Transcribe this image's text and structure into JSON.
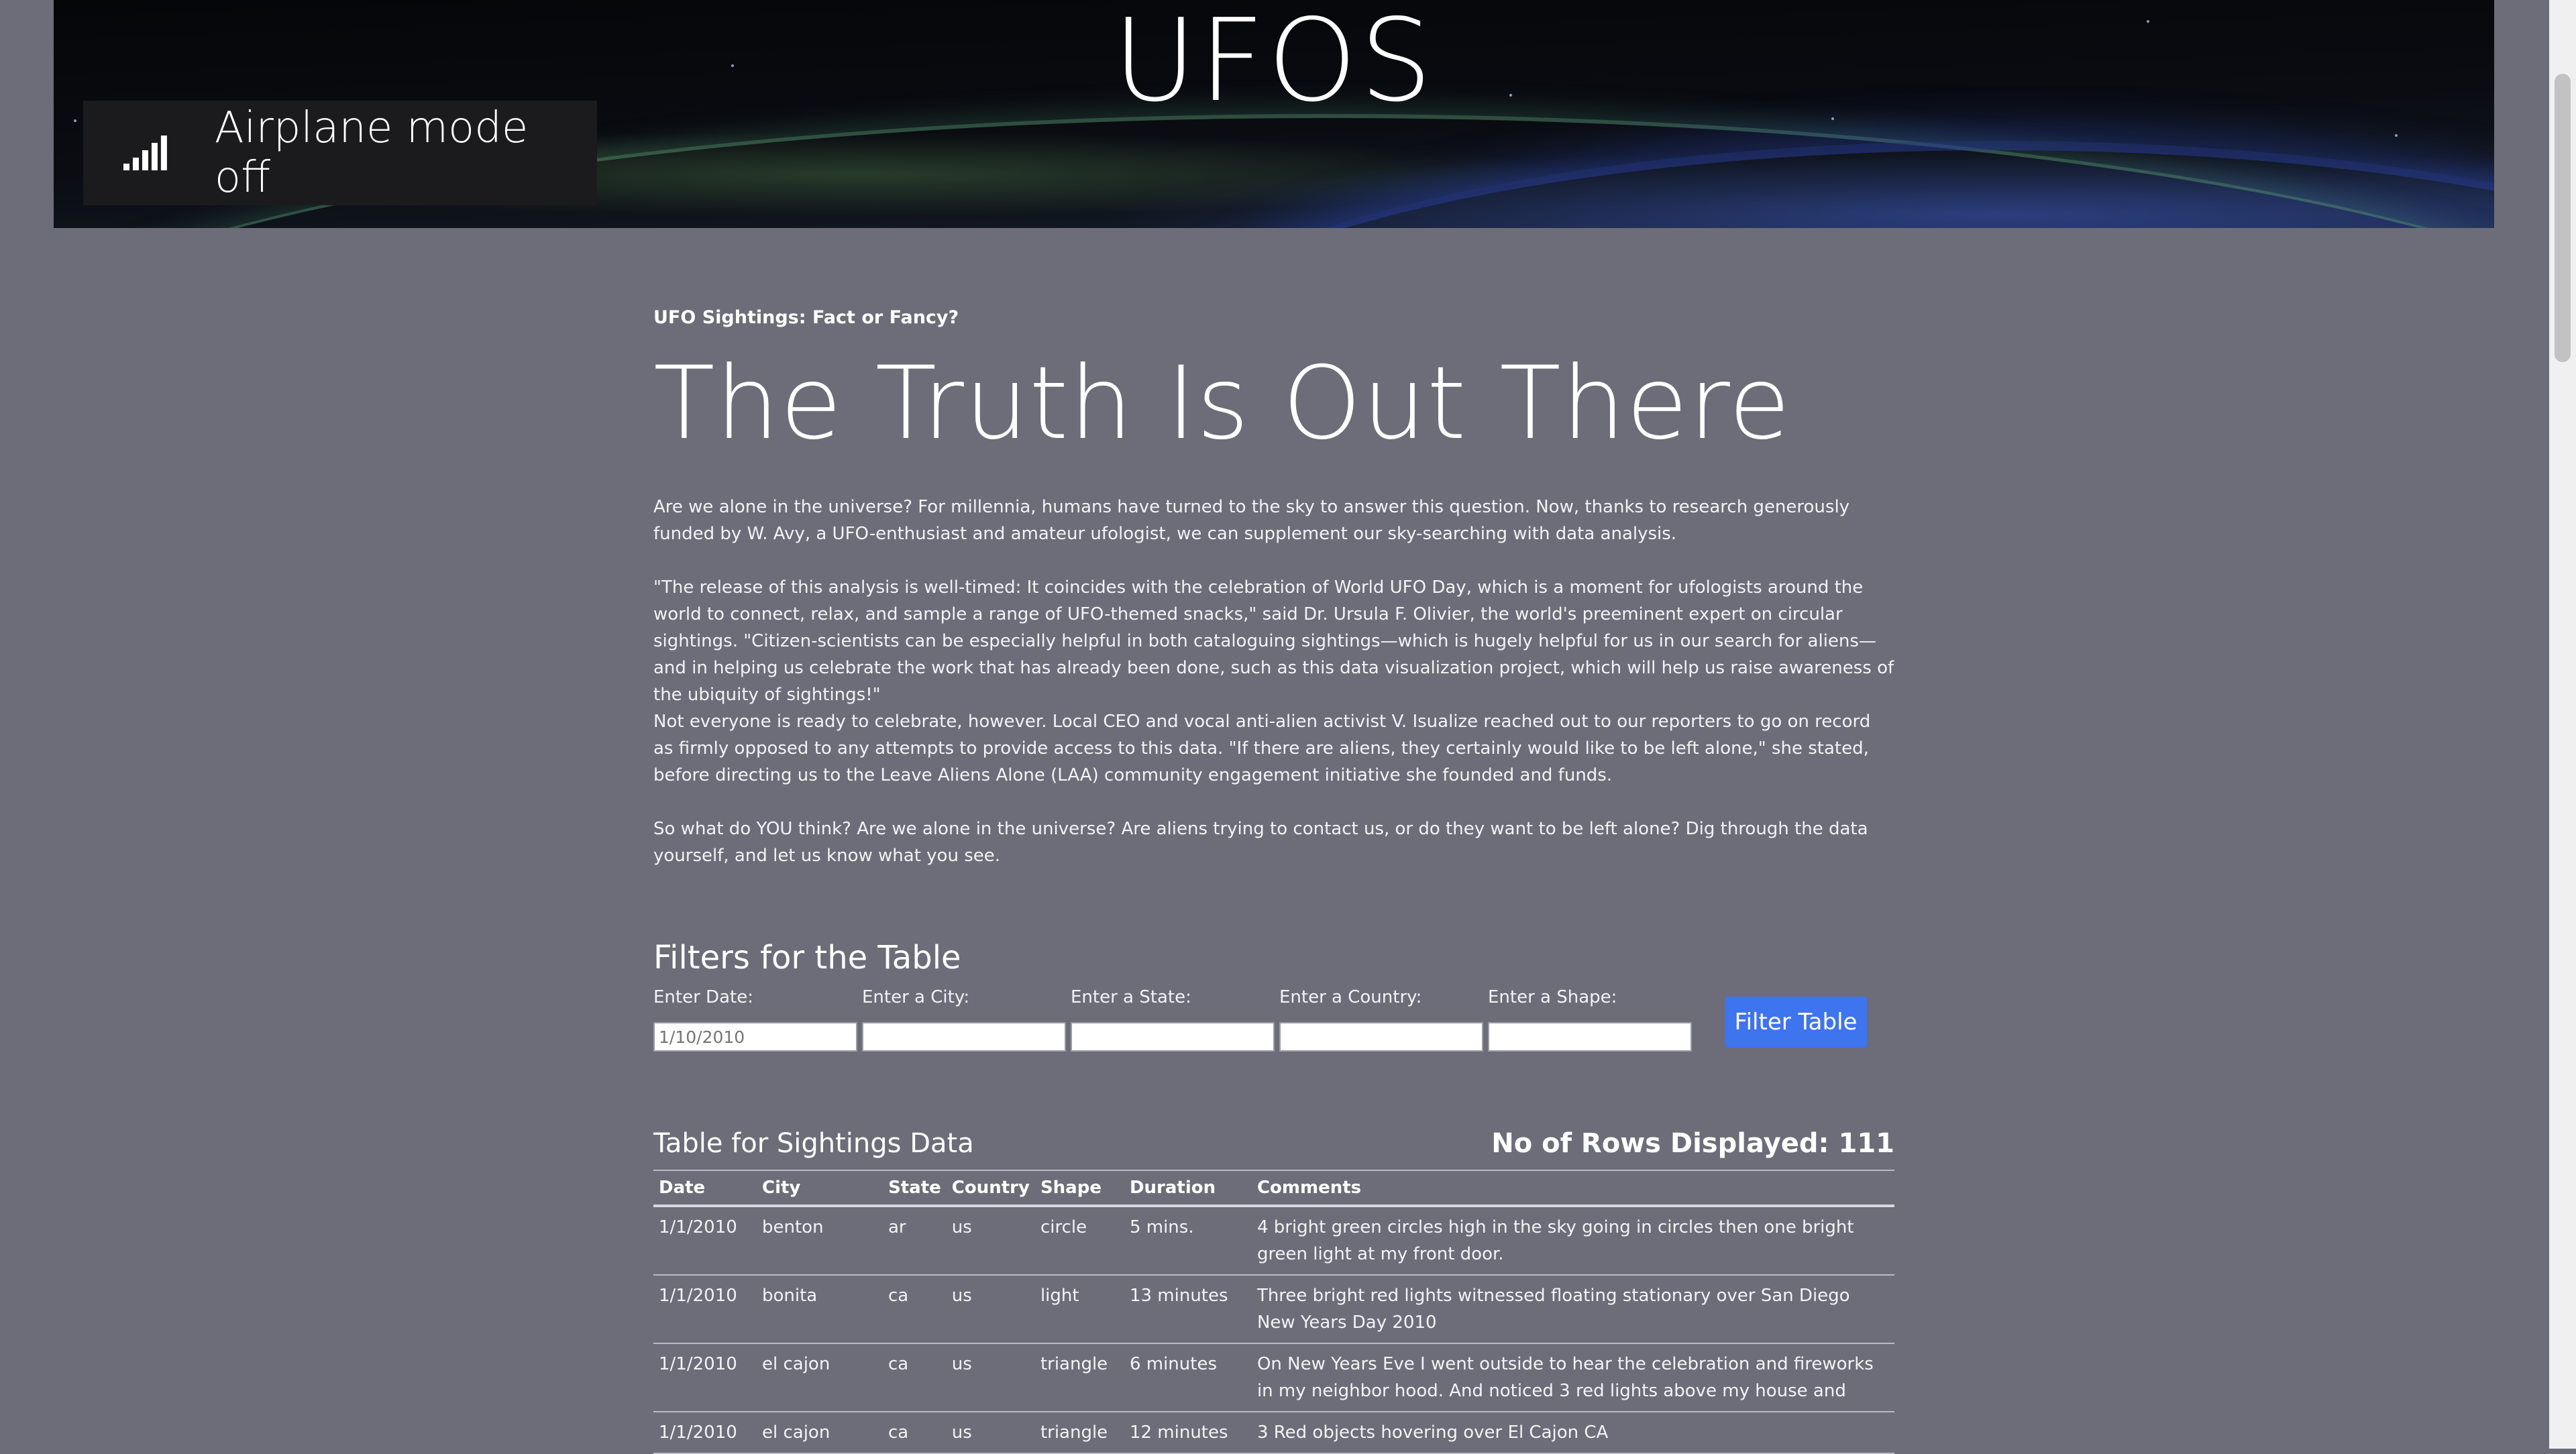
{
  "hero": {
    "title": "UFOS"
  },
  "toast": {
    "icon": "cellular-signal-icon",
    "text": "Airplane mode off"
  },
  "article": {
    "kicker": "UFO Sightings: Fact or Fancy?",
    "headline": "The Truth Is Out There",
    "paragraphs": [
      "Are we alone in the universe? For millennia, humans have turned to the sky to answer this question. Now, thanks to research generously funded by W. Avy, a UFO-enthusiast and amateur ufologist, we can supplement our sky-searching with data analysis.",
      "\"The release of this analysis is well-timed: It coincides with the celebration of World UFO Day, which is a moment for ufologists around the world to connect, relax, and sample a range of UFO-themed snacks,\" said Dr. Ursula F. Olivier, the world's preeminent expert on circular sightings. \"Citizen-scientists can be especially helpful in both cataloguing sightings—which is hugely helpful for us in our search for aliens—and in helping us celebrate the work that has already been done, such as this data visualization project, which will help us raise awareness of the ubiquity of sightings!\"",
      "Not everyone is ready to celebrate, however. Local CEO and vocal anti-alien activist V. Isualize reached out to our reporters to go on record as firmly opposed to any attempts to provide access to this data. \"If there are aliens, they certainly would like to be left alone,\" she stated, before directing us to the Leave Aliens Alone (LAA) community engagement initiative she founded and funds.",
      "So what do YOU think? Are we alone in the universe? Are aliens trying to contact us, or do they want to be left alone? Dig through the data yourself, and let us know what you see."
    ]
  },
  "filters": {
    "title": "Filters for the Table",
    "fields": [
      {
        "label": "Enter Date:",
        "placeholder": "1/10/2010"
      },
      {
        "label": "Enter a City:",
        "placeholder": ""
      },
      {
        "label": "Enter a State:",
        "placeholder": ""
      },
      {
        "label": "Enter a Country:",
        "placeholder": ""
      },
      {
        "label": "Enter a Shape:",
        "placeholder": ""
      }
    ],
    "button": "Filter Table"
  },
  "table": {
    "title": "Table for Sightings Data",
    "rows_label": "No of Rows Displayed:",
    "rows_count": "111",
    "headers": [
      "Date",
      "City",
      "State",
      "Country",
      "Shape",
      "Duration",
      "Comments"
    ],
    "rows": [
      [
        "1/1/2010",
        "benton",
        "ar",
        "us",
        "circle",
        "5 mins.",
        "4 bright green circles high in the sky going in circles then one bright green light at my front door."
      ],
      [
        "1/1/2010",
        "bonita",
        "ca",
        "us",
        "light",
        "13 minutes",
        "Three bright red lights witnessed floating stationary over San Diego New Years Day 2010"
      ],
      [
        "1/1/2010",
        "el cajon",
        "ca",
        "us",
        "triangle",
        "6 minutes",
        "On New Years Eve I went outside to hear the celebration and fireworks in my neighbor hood. And noticed 3 red lights above my house and"
      ],
      [
        "1/1/2010",
        "el cajon",
        "ca",
        "us",
        "triangle",
        "12 minutes",
        "3 Red objects hovering over El Cajon CA"
      ]
    ]
  }
}
